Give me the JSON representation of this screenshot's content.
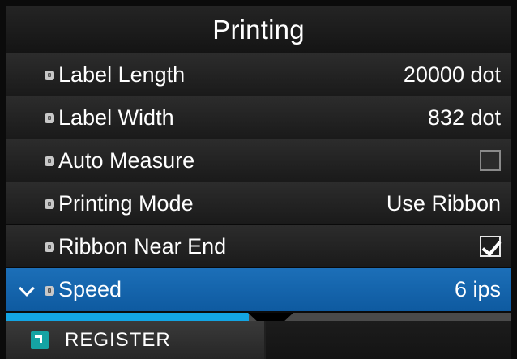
{
  "screen": {
    "title": "Printing"
  },
  "rows": [
    {
      "label": "Label Length",
      "value": "20000 dot",
      "kind": "value"
    },
    {
      "label": "Label Width",
      "value": "832 dot",
      "kind": "value"
    },
    {
      "label": "Auto Measure",
      "kind": "checkbox",
      "checked": false
    },
    {
      "label": "Printing Mode",
      "value": "Use Ribbon",
      "kind": "value"
    },
    {
      "label": "Ribbon Near End",
      "kind": "checkbox",
      "checked": true
    },
    {
      "label": "Speed",
      "value": "6 ips",
      "kind": "value",
      "selected": true
    }
  ],
  "icons": {
    "row_icon": "lock-icon",
    "selected_row_icon": "chevron-down-icon",
    "softkey_icon": "register-icon"
  },
  "scroll": {
    "position_fraction": 0.48
  },
  "softkeys": {
    "left_label": "REGISTER"
  },
  "colors": {
    "selected_row": "#1c6fb8",
    "progress": "#13a5e4",
    "softkey_icon": "#15a3a3"
  }
}
